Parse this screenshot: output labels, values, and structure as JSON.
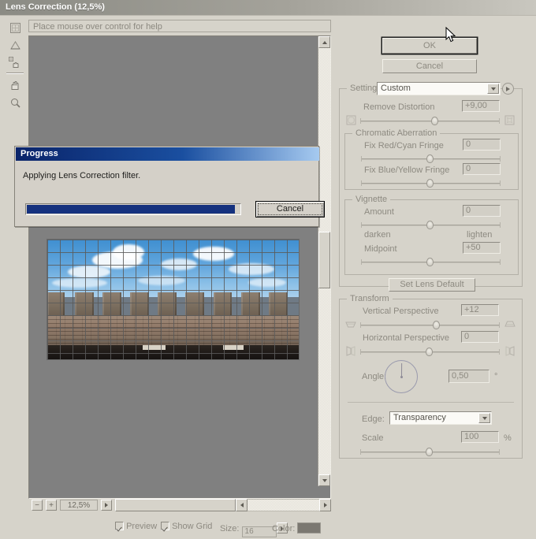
{
  "window": {
    "title": "Lens Correction (12,5%)",
    "help_placeholder": "Place mouse over control for help"
  },
  "tools": [
    {
      "name": "remove-distortion-tool",
      "label": "Remove Distortion Tool"
    },
    {
      "name": "straighten-tool",
      "label": "Straighten Tool"
    },
    {
      "name": "move-grid-tool",
      "label": "Move Grid Tool"
    },
    {
      "name": "hand-tool",
      "label": "Hand Tool"
    },
    {
      "name": "zoom-tool",
      "label": "Zoom Tool"
    }
  ],
  "preview": {
    "zoom_level": "12,5%",
    "zoom_out_label": "−",
    "zoom_in_label": "+"
  },
  "bottom_options": {
    "preview_label": "Preview",
    "preview_checked": true,
    "show_grid_label": "Show Grid",
    "show_grid_checked": true,
    "size_label": "Size:",
    "size_value": "16",
    "color_label": "Color:",
    "color_value": "#7b7871"
  },
  "buttons": {
    "ok": "OK",
    "cancel": "Cancel",
    "set_lens_default": "Set Lens Default"
  },
  "settings": {
    "label": "Settings:",
    "value": "Custom",
    "remove_distortion_label": "Remove Distortion",
    "remove_distortion_value": "+9,00"
  },
  "chromatic": {
    "title": "Chromatic Aberration",
    "red_cyan_label": "Fix Red/Cyan Fringe",
    "red_cyan_value": "0",
    "blue_yellow_label": "Fix Blue/Yellow Fringe",
    "blue_yellow_value": "0"
  },
  "vignette": {
    "title": "Vignette",
    "amount_label": "Amount",
    "amount_value": "0",
    "darken_label": "darken",
    "lighten_label": "lighten",
    "midpoint_label": "Midpoint",
    "midpoint_value": "+50"
  },
  "transform": {
    "title": "Transform",
    "vertical_label": "Vertical Perspective",
    "vertical_value": "+12",
    "horizontal_label": "Horizontal Perspective",
    "horizontal_value": "0",
    "angle_label": "Angle:",
    "angle_value": "0,50",
    "angle_unit": "°",
    "edge_label": "Edge:",
    "edge_value": "Transparency",
    "scale_label": "Scale",
    "scale_value": "100",
    "scale_unit": "%"
  },
  "progress_dialog": {
    "title": "Progress",
    "message": "Applying Lens Correction filter.",
    "cancel_label": "Cancel",
    "percent": 97
  }
}
